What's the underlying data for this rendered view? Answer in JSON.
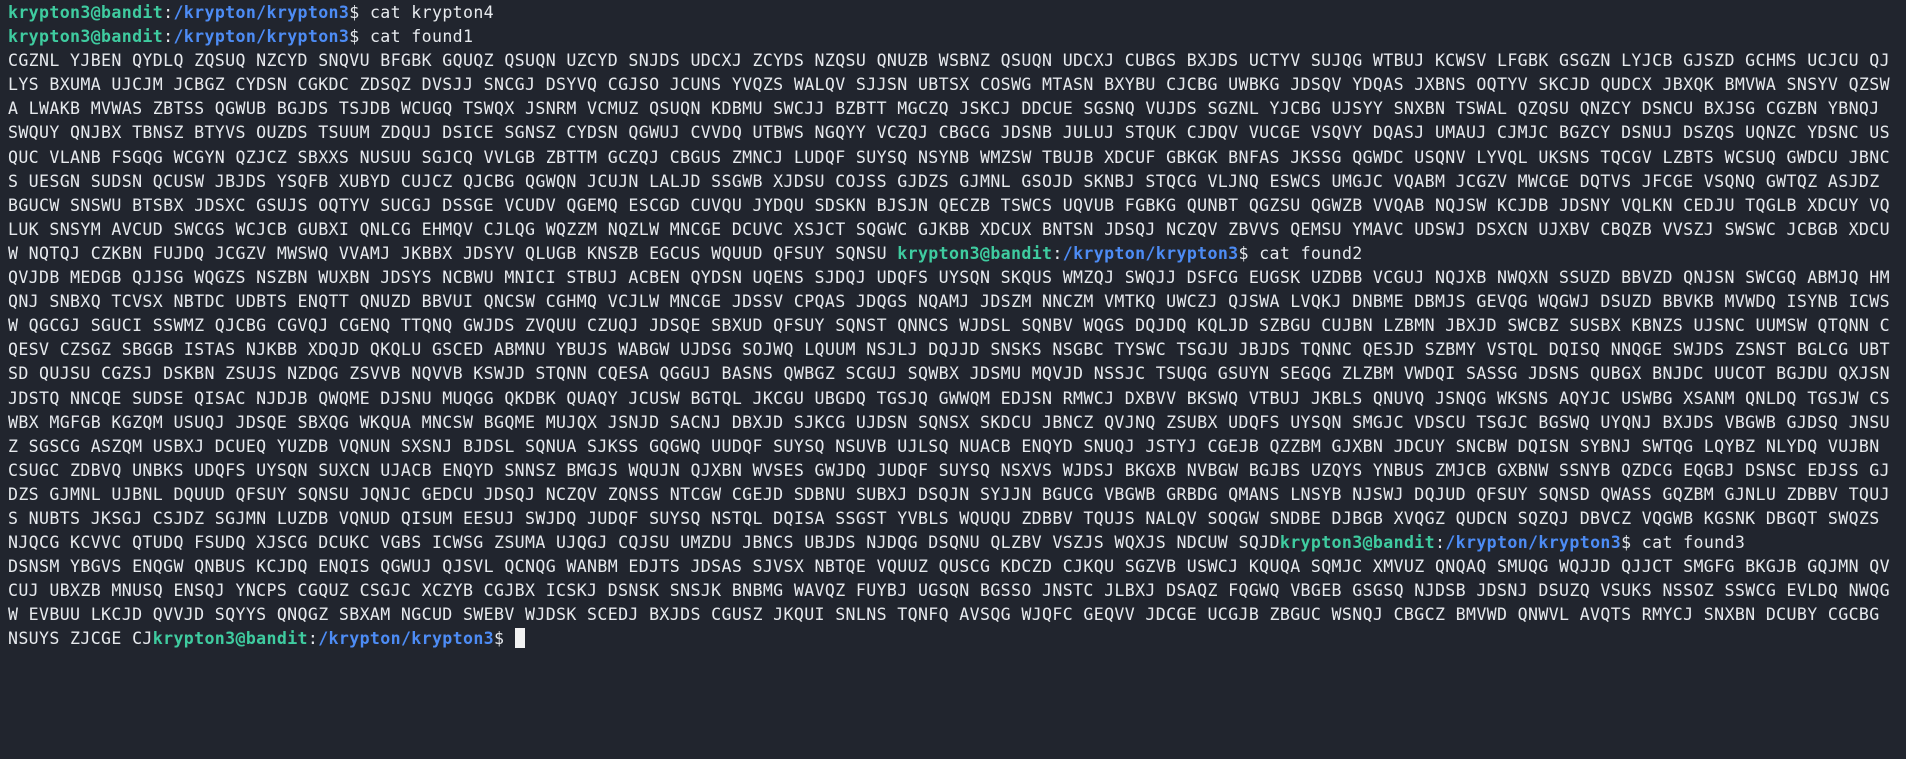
{
  "terminal": {
    "prompt_user": "krypton3@bandit",
    "prompt_path": "/krypton/krypton3",
    "commands": [
      "cat krypton4",
      "cat found1",
      "cat found2",
      "cat found3"
    ],
    "found1": "CGZNL YJBEN QYDLQ ZQSUQ NZCYD SNQVU BFGBK GQUQZ QSUQN UZCYD SNJDS UDCXJ ZCYDS NZQSU QNUZB WSBNZ QSUQN UDCXJ CUBGS BXJDS UCTYV SUJQG WTBUJ KCWSV LFGBK GSGZN LYJCB GJSZD GCHMS UCJCU QJLYS BXUMA UJCJM JCBGZ CYDSN CGKDC ZDSQZ DVSJJ SNCGJ DSYVQ CGJSO JCUNS YVQZS WALQV SJJSN UBTSX COSWG MTASN BXYBU CJCBG UWBKG JDSQV YDQAS JXBNS OQTYV SKCJD QUDCX JBXQK BMVWA SNSYV QZSWA LWAKB MVWAS ZBTSS QGWUB BGJDS TSJDB WCUGQ TSWQX JSNRM VCMUZ QSUQN KDBMU SWCJJ BZBTT MGCZQ JSKCJ DDCUE SGSNQ VUJDS SGZNL YJCBG UJSYY SNXBN TSWAL QZQSU QNZCY DSNCU BXJSG CGZBN YBNQJ SWQUY QNJBX TBNSZ BTYVS OUZDS TSUUM ZDQUJ DSICE SGNSZ CYDSN QGWUJ CVVDQ UTBWS NGQYY VCZQJ CBGCG JDSNB JULUJ STQUK CJDQV VUCGE VSQVY DQASJ UMAUJ CJMJC BGZCY DSNUJ DSZQS UQNZC YDSNC USQUC VLANB FSGQG WCGYN QZJCZ SBXXS NUSUU SGJCQ VVLGB ZBTTM GCZQJ CBGUS ZMNCJ LUDQF SUYSQ NSYNB WMZSW TBUJB XDCUF GBKGK BNFAS JKSSG QGWDC USQNV LYVQL UKSNS TQCGV LZBTS WCSUQ GWDCU JBNCS UESGN SUDSN QCUSW JBJDS YSQFB XUBYD CUJCZ QJCBG QGWQN JCUJN LALJD SSGWB XJDSU COJSS GJDZS GJMNL GSOJD SKNBJ STQCG VLJNQ ESWCS UMGJC VQABM JCGZV MWCGE DQTVS JFCGE VSQNQ GWTQZ ASJDZ BGUCW SNSWU BTSBX JDSXC GSUJS OQTYV SUCGJ DSSGE VCUDV QGEMQ ESCGD CUVQU JYDQU SDSKN BJSJN QECZB TSWCS UQVUB FGBKG QUNBT QGZSU QGWZB VVQAB NQJSW KCJDB JDSNY VQLKN CEDJU TQGLB XDCUY VQLUK SNSYM AVCUD SWCGS WCJCB GUBXI QNLCG EHMQV CJLQG WQZZM NQZLW MNCGE DCUVC XSJCT SQGWC GJKBB XDCUX BNTSN JDSQJ NCZQV ZBVVS QEMSU YMAVC UDSWJ DSXCN UJXBV CBQZB VVSZJ SWSWC JCBGB XDCUW NQTQJ CZKBN FUJDQ JCGZV MWSWQ VVAMJ JKBBX JDSYV QLUGB KNSZB EGCUS WQUUD QFSUY SQNSU",
    "found2": "QVJDB MEDGB QJJSG WQGZS NSZBN WUXBN JDSYS NCBWU MNICI STBUJ ACBEN QYDSN UQENS SJDQJ UDQFS UYSQN SKQUS WMZQJ SWQJJ DSFCG EUGSK UZDBB VCGUJ NQJXB NWQXN SSUZD BBVZD QNJSN SWCGQ ABMJQ HMQNJ SNBXQ TCVSX NBTDC UDBTS ENQTT QNUZD BBVUI QNCSW CGHMQ VCJLW MNCGE JDSSV CPQAS JDQGS NQAMJ JDSZM NNCZM VMTKQ UWCZJ QJSWA LVQKJ DNBME DBMJS GEVQG WQGWJ DSUZD BBVKB MVWDQ ISYNB ICWSW QGCGJ SGUCI SSWMZ QJCBG CGVQJ CGENQ TTQNQ GWJDS ZVQUU CZUQJ JDSQE SBXUD QFSUY SQNST QNNCS WJDSL SQNBV WQGS DQJDQ KQLJD SZBGU CUJBN LZBMN JBXJD SWCBZ SUSBX KBNZS UJSNC UUMSW QTQNN CQESV CZSGZ SBGGB ISTAS NJKBB XDQJD QKQLU GSCED ABMNU YBUJS WABGW UJDSG SOJWQ LQUUM NSJLJ DQJJD SNSKS NSGBC TYSWC TSGJU JBJDS TQNNC QESJD SZBMY VSTQL DQISQ NNQGE SWJDS ZSNST BGLCG UBTSD QUJSU CGZSJ DSKBN ZSUJS NZDQG ZSVVB NQVVB KSWJD STQNN CQESA QGGUJ BASNS QWBGZ SCGUJ SQWBX JDSMU MQVJD NSSJC TSUQG GSUYN SEGQG ZLZBM VWDQI SASSG JDSNS QUBGX BNJDC UUCOT BGJDU QXJSN JDSTQ NNCQE SUDSE QISAC NJDJB QWQME DJSNU MUQGG QKDBK QUAQY JCUSW BGTQL JKCGU UBGDQ TGSJQ GWWQM EDJSN RMWCJ DXBVV BKSWQ VTBUJ JKBLS QNUVQ JSNQG WKSNS AQYJC USWBG XSANM QNLDQ TGSJW CSWBX MGFGB KGZQM USUQJ JDSQE SBXQG WKQUA MNCSW BGQME MUJQX JSNJD SACNJ DBXJD SJKCG UJDSN SQNSX SKDCU JBNCZ QVJNQ ZSUBX UDQFS UYSQN SMGJC VDSCU TSGJC BGSWQ UYQNJ BXJDS VBGWB GJDSQ JNSUZ SGSCG ASZQM USBXJ DCUEQ YUZDB VQNUN SXSNJ BJDSL SQNUA SJKSS GQGWQ UUDQF SUYSQ NSUVB UJLSQ NUACB ENQYD SNUQJ JSTYJ CGEJB QZZBM GJXBN JDCUY SNCBW DQISN SYBNJ SWTQG LQYBZ NLYDQ VUJBN CSUGC ZDBVQ UNBKS UDQFS UYSQN SUXCN UJACB ENQYD SNNSZ BMGJS WQUJN QJXBN WVSES GWJDQ JUDQF SUYSQ NSXVS WJDSJ BKGXB NVBGW BGJBS UZQYS YNBUS ZMJCB GXBNW SSNYB QZDCG EQGBJ DSNSC EDJSS GJDZS GJMNL UJBNL DQUUD QFSUY SQNSU JQNJC GEDCU JDSQJ NCZQV ZQNSS NTCGW CGEJD SDBNU SUBXJ DSQJN SYJJN BGUCG VBGWB GRBDG QMANS LNSYB NJSWJ DQJUD QFSUY SQNSD QWASS GQZBM GJNLU ZDBBV TQUJS NUBTS JKSGJ CSJDZ SGJMN LUZDB VQNUD QISUM EESUJ SWJDQ JUDQF SUYSQ NSTQL DQISA SSGST YVBLS WQUQU ZDBBV TQUJS NALQV SOQGW SNDBE DJBGB XVQGZ QUDCN SQZQJ DBVCZ VQGWB KGSNK DBGQT SWQZS NJQCG KCVVC QTUDQ FSUDQ XJSCG DCUKC VGBS ICWSG ZSUMA UJQGJ CQJSU UMZDU JBNCS UBJDS NJDQG DSQNU QLZBV VSZJS WQXJS NDCUW SQJD",
    "found3": "DSNSM YBGVS ENQGW QNBUS KCJDQ ENQIS QGWUJ QJSVL QCNQG WANBM EDJTS JDSAS SJVSX NBTQE VQUUZ QUSCG KDCZD CJKQU SGZVB USWCJ KQUQA SQMJC XMVUZ QNQAQ SMUQG WQJJD QJJCT SMGFG BKGJB GQJMN QVCUJ UBXZB MNUSQ ENSQJ YNCPS CGQUZ CSGJC XCZYB CGJBX ICSKJ DSNSK SNSJK BNBMG WAVQZ FUYBJ UGSQN BGSSO JNSTC JLBXJ DSAQZ FQGWQ VBGEB GSGSQ NJDSB JDSNJ DSUZQ VSUKS NSSOZ SSWCG EVLDQ NWQGW EVBUU LKCJD QVVJD SQYYS QNQGZ SBXAM NGCUD SWEBV WJDSK SCEDJ BXJDS CGUSZ JKQUI SNLNS TQNFQ AVSQG WJQFC GEQVV JDCGE UCGJB ZBGUC WSNQJ CBGCZ BMVWD QNWVL AVQTS RMYCJ SNXBN DCUBY CGCBG NSUYS ZJCGE CJ"
  }
}
